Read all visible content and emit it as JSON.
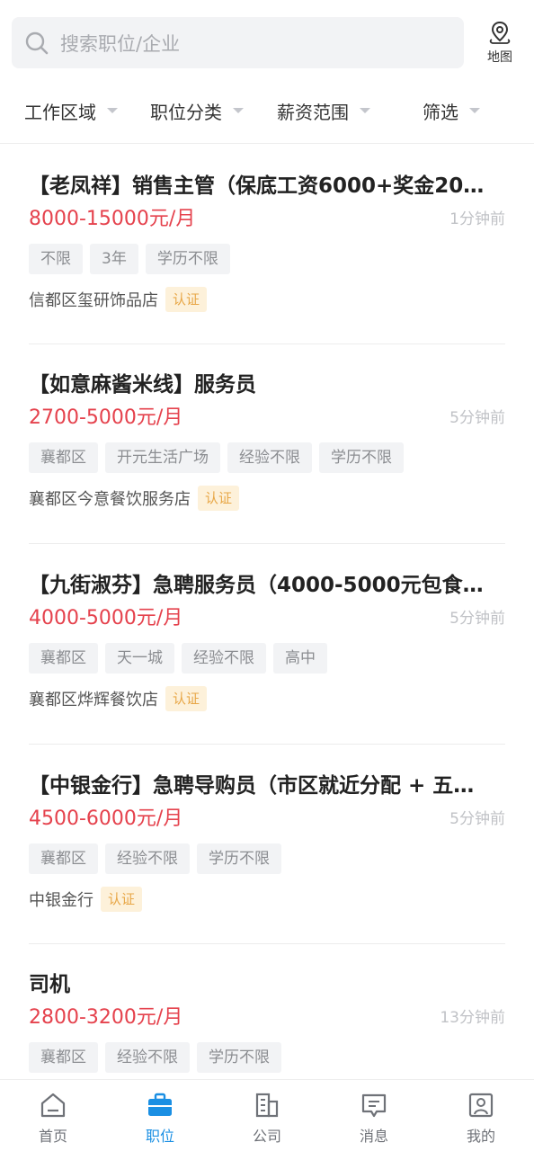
{
  "search": {
    "placeholder": "搜索职位/企业",
    "map_label": "地图"
  },
  "filters": [
    {
      "label": "工作区域"
    },
    {
      "label": "职位分类"
    },
    {
      "label": "薪资范围"
    },
    {
      "label": "筛选"
    }
  ],
  "jobs": [
    {
      "title": "【老凤祥】销售主管（保底工资6000+奖金20…",
      "salary": "8000-15000元/月",
      "time": "1分钟前",
      "tags": [
        "不限",
        "3年",
        "学历不限"
      ],
      "company": "信都区玺研饰品店",
      "cert": "认证"
    },
    {
      "title": "【如意麻酱米线】服务员",
      "salary": "2700-5000元/月",
      "time": "5分钟前",
      "tags": [
        "襄都区",
        "开元生活广场",
        "经验不限",
        "学历不限"
      ],
      "company": "襄都区今意餐饮服务店",
      "cert": "认证"
    },
    {
      "title": "【九街淑芬】急聘服务员（4000-5000元包食…",
      "salary": "4000-5000元/月",
      "time": "5分钟前",
      "tags": [
        "襄都区",
        "天一城",
        "经验不限",
        "高中"
      ],
      "company": "襄都区烨辉餐饮店",
      "cert": "认证"
    },
    {
      "title": "【中银金行】急聘导购员（市区就近分配 + 五…",
      "salary": "4500-6000元/月",
      "time": "5分钟前",
      "tags": [
        "襄都区",
        "经验不限",
        "学历不限"
      ],
      "company": "中银金行",
      "cert": "认证"
    },
    {
      "title": "司机",
      "salary": "2800-3200元/月",
      "time": "13分钟前",
      "tags": [
        "襄都区",
        "经验不限",
        "学历不限"
      ],
      "company": "",
      "cert": ""
    }
  ],
  "nav": [
    {
      "label": "首页",
      "icon": "home-icon",
      "active": false
    },
    {
      "label": "职位",
      "icon": "briefcase-icon",
      "active": true
    },
    {
      "label": "公司",
      "icon": "building-icon",
      "active": false
    },
    {
      "label": "消息",
      "icon": "message-icon",
      "active": false
    },
    {
      "label": "我的",
      "icon": "profile-icon",
      "active": false
    }
  ],
  "colors": {
    "accent": "#1a8fe3",
    "salary": "#e5424d",
    "cert_bg": "#fdf1da",
    "cert_text": "#e8a747"
  }
}
